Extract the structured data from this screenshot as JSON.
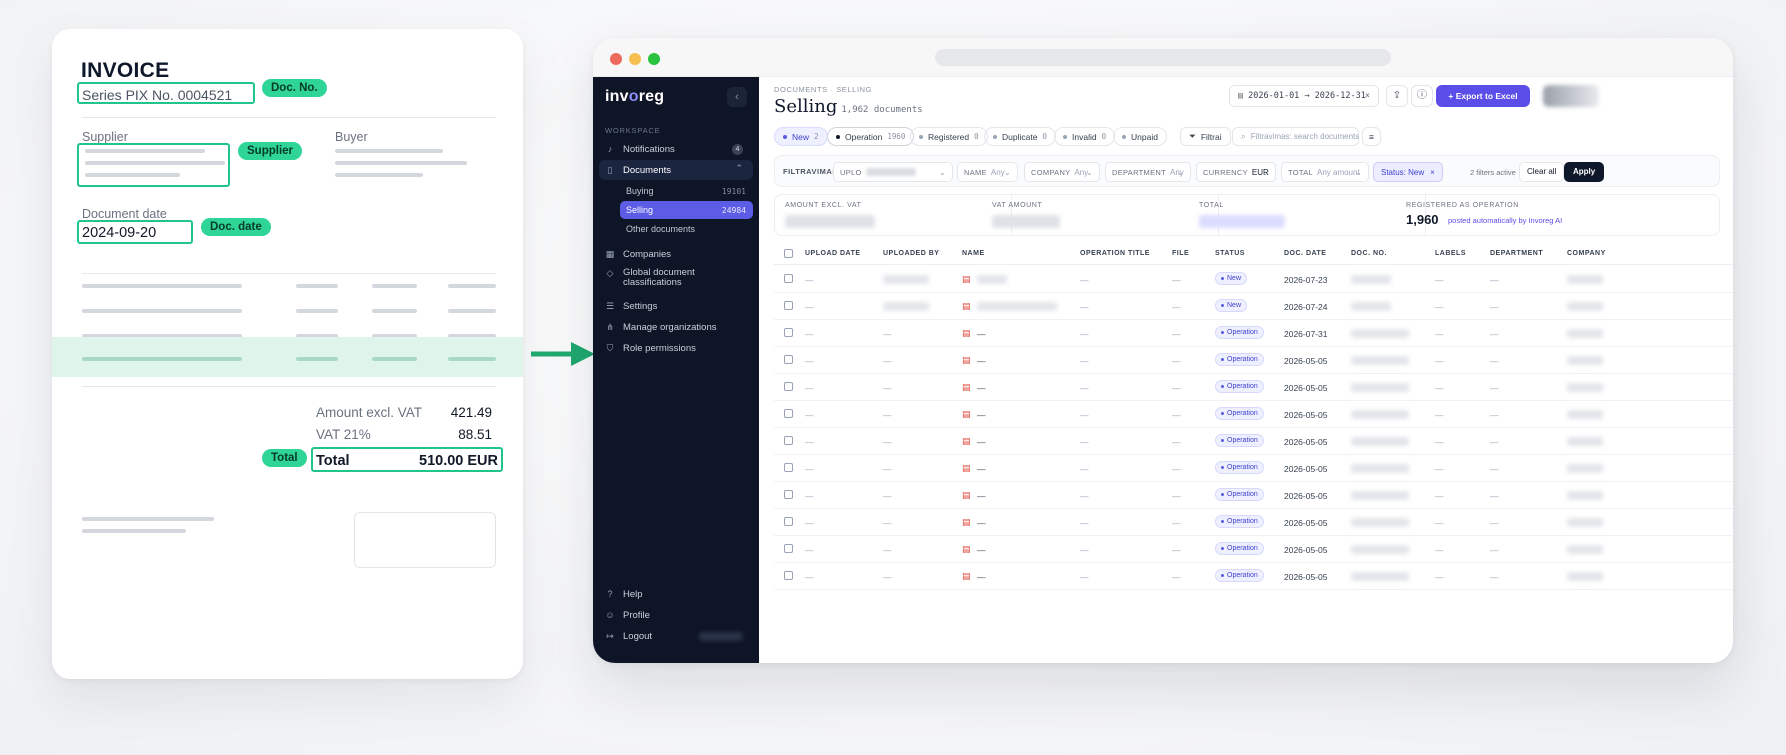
{
  "invoice": {
    "title": "INVOICE",
    "series": "Series PIX  No. 0004521",
    "doc_no_tag": "Doc. No.",
    "supplier_label": "Supplier",
    "supplier_tag": "Supplier",
    "buyer_label": "Buyer",
    "doc_date_label": "Document date",
    "doc_date_value": "2024-09-20",
    "doc_date_tag": "Doc. date",
    "amount_label": "Amount excl. VAT",
    "amount_value": "421.49",
    "vat_label": "VAT 21%",
    "vat_value": "88.51",
    "total_label": "Total",
    "total_value": "510.00 EUR",
    "total_tag": "Total"
  },
  "colors": {
    "accent": "#5b4ee8",
    "highlight": "#21c48a",
    "sidebar": "#0e1526"
  },
  "sidebar": {
    "logo_prefix": "inv",
    "logo_o": "o",
    "logo_suffix": "reg",
    "section": "WORKSPACE",
    "items": [
      {
        "label": "Notifications",
        "icon": "bell-icon",
        "badge": "4"
      },
      {
        "label": "Documents",
        "icon": "document-icon"
      },
      {
        "label": "Companies",
        "icon": "building-icon"
      },
      {
        "label": "Global document classifications",
        "icon": "tag-icon"
      },
      {
        "label": "Settings",
        "icon": "sliders-icon"
      },
      {
        "label": "Manage organizations",
        "icon": "org-icon"
      },
      {
        "label": "Role permissions",
        "icon": "shield-icon"
      }
    ],
    "sub": [
      {
        "label": "Buying",
        "count": "19101"
      },
      {
        "label": "Selling",
        "count": "24984"
      },
      {
        "label": "Other documents",
        "count": ""
      }
    ],
    "bottom": [
      {
        "label": "Help",
        "icon": "help-icon"
      },
      {
        "label": "Profile",
        "icon": "user-icon"
      },
      {
        "label": "Logout",
        "icon": "logout-icon"
      }
    ]
  },
  "header": {
    "breadcrumb": "DOCUMENTS · SELLING",
    "title": "Selling",
    "count": "1,962 documents",
    "date_range": "2026-01-01 → 2026-12-31",
    "date_clear": "×",
    "export_label": "+ Export to Excel"
  },
  "chips": [
    {
      "label": "New",
      "count": "2"
    },
    {
      "label": "Operation",
      "count": "1960"
    },
    {
      "label": "Registered",
      "count": "0"
    },
    {
      "label": "Duplicate",
      "count": "0"
    },
    {
      "label": "Invalid",
      "count": "0"
    },
    {
      "label": "Unpaid",
      "count": ""
    }
  ],
  "filter_button": "Filtrai",
  "search_placeholder": "Filtravimas: search documents",
  "filters": {
    "label": "FILTRAVIMAS",
    "upload": "UPLO",
    "name": "NAME",
    "name_value": "Any",
    "company": "COMPANY",
    "company_value": "Any",
    "department": "DEPARTMENT",
    "department_value": "Any",
    "currency": "CURRENCY",
    "currency_value": "EUR",
    "total": "TOTAL",
    "total_value": "Any amount",
    "status": "Status: New",
    "status_x": "×",
    "active": "2 filters active",
    "clear": "Clear all",
    "apply": "Apply"
  },
  "stats": {
    "amount": "AMOUNT EXCL. VAT",
    "vat": "VAT AMOUNT",
    "total": "TOTAL",
    "registered": "REGISTERED AS OPERATION",
    "registered_value": "1,960",
    "registered_note": "posted automatically by Invoreg AI"
  },
  "table": {
    "columns": [
      "UPLOAD DATE",
      "UPLOADED BY",
      "NAME",
      "OPERATION TITLE",
      "FILE",
      "STATUS",
      "DOC. DATE",
      "DOC. NO.",
      "LABELS",
      "DEPARTMENT",
      "COMPANY"
    ],
    "dash": "—",
    "rows": [
      {
        "status": "New",
        "date": "2026-07-23"
      },
      {
        "status": "New",
        "date": "2026-07-24"
      },
      {
        "status": "Operation",
        "date": "2026-07-31"
      },
      {
        "status": "Operation",
        "date": "2026-05-05"
      },
      {
        "status": "Operation",
        "date": "2026-05-05"
      },
      {
        "status": "Operation",
        "date": "2026-05-05"
      },
      {
        "status": "Operation",
        "date": "2026-05-05"
      },
      {
        "status": "Operation",
        "date": "2026-05-05"
      },
      {
        "status": "Operation",
        "date": "2026-05-05"
      },
      {
        "status": "Operation",
        "date": "2026-05-05"
      },
      {
        "status": "Operation",
        "date": "2026-05-05"
      },
      {
        "status": "Operation",
        "date": "2026-05-05"
      }
    ]
  }
}
